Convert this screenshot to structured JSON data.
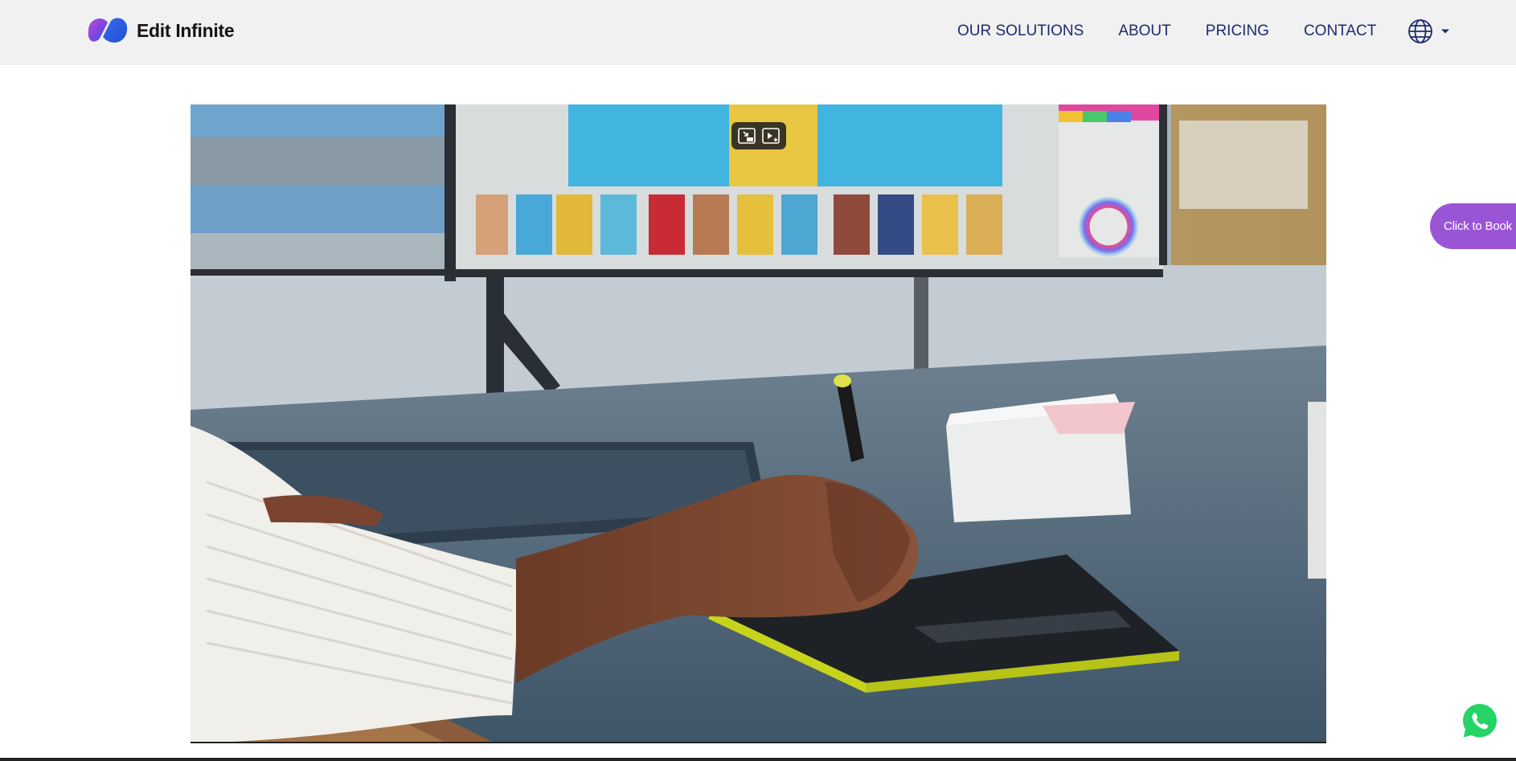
{
  "brand": {
    "name": "Edit Infinite"
  },
  "nav": {
    "items": [
      {
        "label": "OUR SOLUTIONS"
      },
      {
        "label": "ABOUT"
      },
      {
        "label": "PRICING"
      },
      {
        "label": "CONTACT"
      }
    ],
    "language_icon": "globe-icon",
    "language_caret": "caret-down-icon"
  },
  "video": {
    "controls": [
      {
        "icon": "exit-picture-in-picture-icon"
      },
      {
        "icon": "auto-picture-in-picture-icon"
      }
    ]
  },
  "cta": {
    "book_label": "Click to Book"
  },
  "floating": {
    "chat_icon": "whatsapp-icon"
  },
  "colors": {
    "header_bg": "#f1f1f1",
    "nav_text": "#1d2b6e",
    "book_bg": "#9a55d6",
    "whatsapp": "#25d366"
  }
}
